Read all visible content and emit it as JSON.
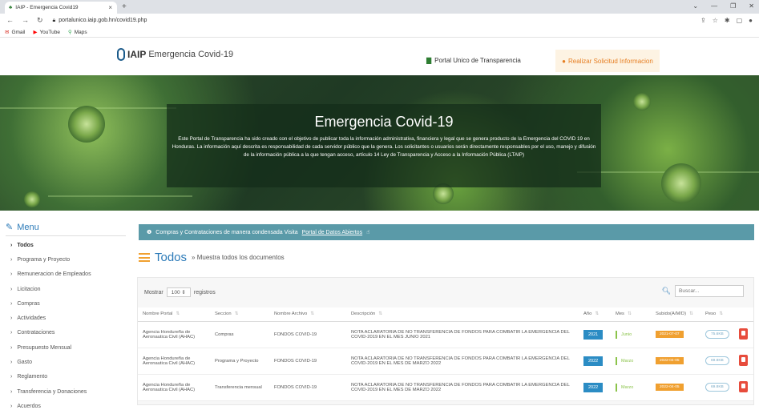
{
  "browser": {
    "tab_title": "IAIP - Emergencia Covid19",
    "url": "portalunico.iaip.gob.hn/covid19.php",
    "bookmarks": [
      "Gmail",
      "YouTube",
      "Maps"
    ]
  },
  "header": {
    "logo_text": "IAIP",
    "logo_sub": "Emergencia Covid-19",
    "portal_link": "Portal Unico de Transparencia",
    "request_button": "Realizar Solicitud Informacion"
  },
  "hero": {
    "title": "Emergencia Covid-19",
    "text": "Este Portal de Transparencia ha sido creado con el objetivo de publicar toda la información administrativa, financiera y legal que se genera producto de la Emergencia del COVID 19 en Honduras. La información aquí descrita es responsabilidad de cada servidor público que la genera. Los solicitantes o usuarios serán directamente responsables por el uso, manejo y difusión de la información pública a la que tengan acceso, artículo 14 Ley de Transparencia y Acceso a la Información Pública (LTAIP)"
  },
  "sidebar": {
    "title": "Menu",
    "items": [
      {
        "label": "Todos",
        "active": true
      },
      {
        "label": "Programa y Proyecto"
      },
      {
        "label": "Remuneracion de Empleados"
      },
      {
        "label": "Licitacion"
      },
      {
        "label": "Compras"
      },
      {
        "label": "Actividades"
      },
      {
        "label": "Contrataciones"
      },
      {
        "label": "Presupuesto Mensual"
      },
      {
        "label": "Gasto"
      },
      {
        "label": "Reglamento"
      },
      {
        "label": "Transferencia y Donaciones"
      },
      {
        "label": "Acuerdos"
      }
    ]
  },
  "alert": {
    "text": "Compras y Contrataciones de manera condensada Visita",
    "link": "Portal de Datos Abiertos"
  },
  "section": {
    "title": "Todos",
    "subtitle": "» Muestra todos los documentos"
  },
  "table_controls": {
    "show_label": "Mostrar",
    "show_value": "100",
    "records_label": "registros",
    "search_placeholder": "Buscar..."
  },
  "table": {
    "headers": [
      "Nombre Portal",
      "Seccion",
      "Nombre Archivo",
      "Descripción",
      "Año",
      "Mes",
      "Subido(A/M/D)",
      "Peso",
      ""
    ],
    "rows": [
      {
        "portal": "Agencia Hondureña de Aeronautica Civil (AHAC)",
        "seccion": "Compras",
        "archivo": "FONDOS COVID-19",
        "descripcion": "NOTA ACLARATORIA DE NO TRANSFERENCIA DE FONDOS PARA COMBATIR LA EMERGENCIA DEL COVID-2019 EN EL MES JUNIO 2021",
        "anio": "2021",
        "mes": "Junio",
        "subido": "2021-07-07",
        "peso": "75.6KB"
      },
      {
        "portal": "Agencia Hondureña de Aeronautica Civil (AHAC)",
        "seccion": "Programa y Proyecto",
        "archivo": "FONDOS COVID-19",
        "descripcion": "NOTA ACLARATORIA DE NO TRANSFERENCIA DE FONDOS PARA COMBATIR LA EMERGENCIA DEL COVID-2019 EN EL MES DE MARZO 2022",
        "anio": "2022",
        "mes": "Marzo",
        "subido": "2022-04-05",
        "peso": "69.8KB"
      },
      {
        "portal": "Agencia Hondureña de Aeronautica Civil (AHAC)",
        "seccion": "Transferencia mensual",
        "archivo": "FONDOS COVID-19",
        "descripcion": "NOTA ACLARATORIA DE NO TRANSFERENCIA DE FONDOS PARA COMBATIR LA EMERGENCIA DEL COVID-2019 EN EL MES DE MARZO 2022",
        "anio": "2022",
        "mes": "Marzo",
        "subido": "2022-04-05",
        "peso": "69.8KB"
      }
    ]
  }
}
